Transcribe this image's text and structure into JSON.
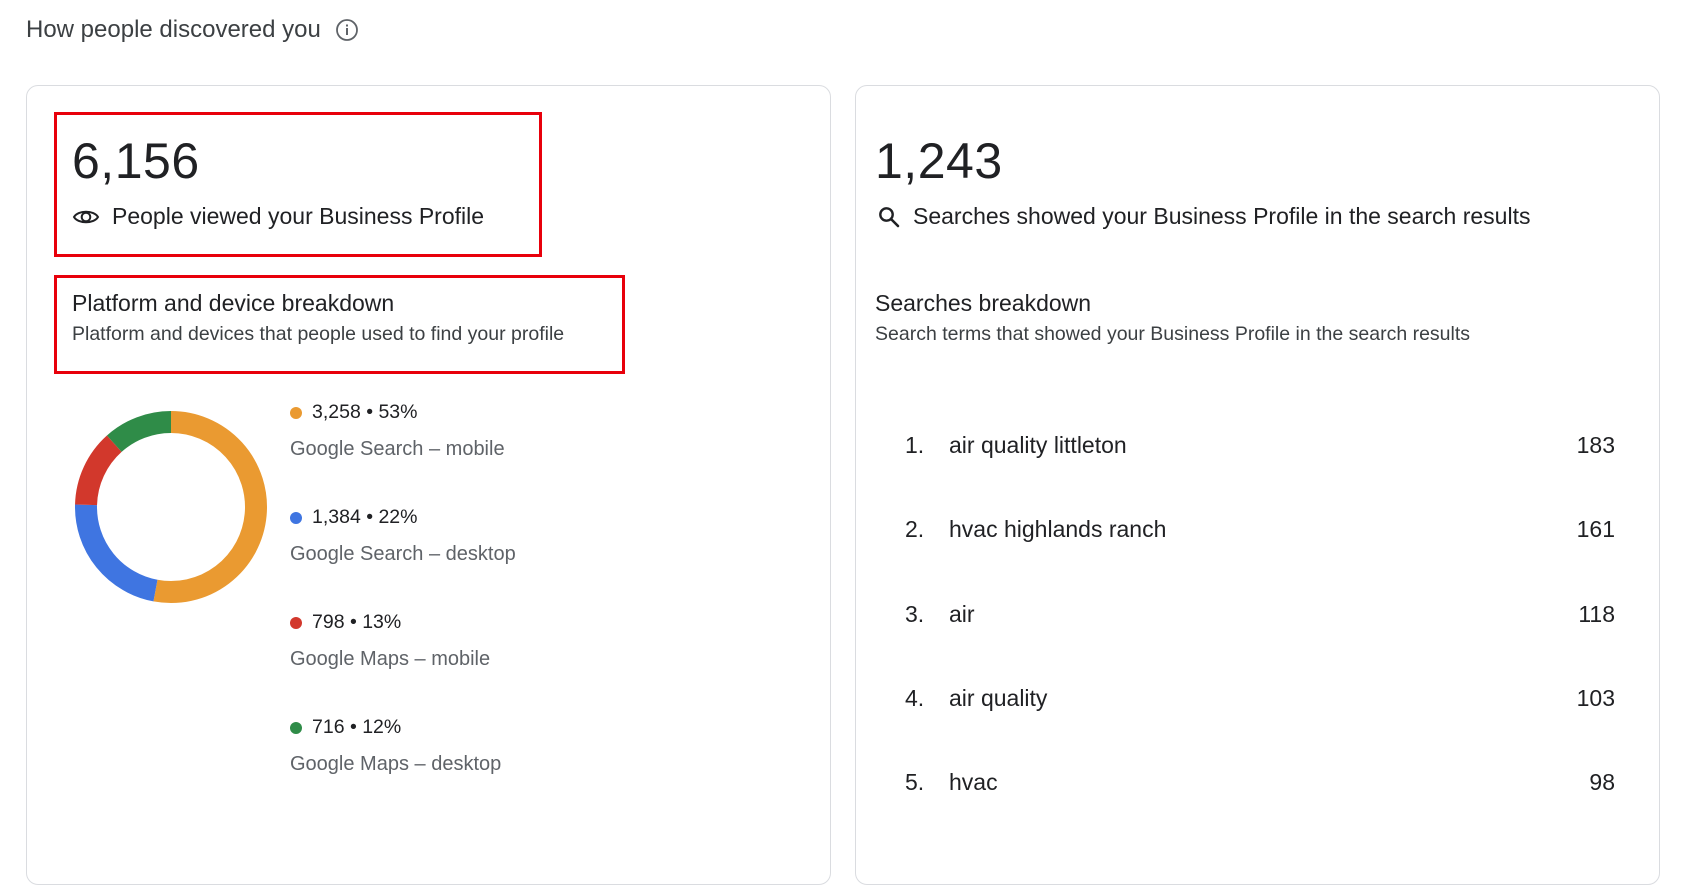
{
  "header": {
    "title": "How people discovered you",
    "info_icon": "info-icon"
  },
  "views_card": {
    "total": "6,156",
    "total_label": "People viewed your Business Profile",
    "total_icon": "eye-icon",
    "breakdown_title": "Platform and device breakdown",
    "breakdown_subtitle": "Platform and devices that people used to find your profile",
    "items": [
      {
        "summary": "3,258 • 53%",
        "label": "Google Search – mobile",
        "value": 3258,
        "percent": 53,
        "color": "#ea9a31"
      },
      {
        "summary": "1,384 • 22%",
        "label": "Google Search – desktop",
        "value": 1384,
        "percent": 22,
        "color": "#3f75e1"
      },
      {
        "summary": "798 • 13%",
        "label": "Google Maps – mobile",
        "value": 798,
        "percent": 13,
        "color": "#d2382c"
      },
      {
        "summary": "716 • 12%",
        "label": "Google Maps – desktop",
        "value": 716,
        "percent": 12,
        "color": "#2f8c48"
      }
    ]
  },
  "searches_card": {
    "total": "1,243",
    "total_label": "Searches showed your Business Profile in the search results",
    "total_icon": "search-icon",
    "breakdown_title": "Searches breakdown",
    "breakdown_subtitle": "Search terms that showed your Business Profile in the search results",
    "terms": [
      {
        "rank": "1.",
        "term": "air quality littleton",
        "count": "183"
      },
      {
        "rank": "2.",
        "term": "hvac highlands ranch",
        "count": "161"
      },
      {
        "rank": "3.",
        "term": "air",
        "count": "118"
      },
      {
        "rank": "4.",
        "term": "air quality",
        "count": "103"
      },
      {
        "rank": "5.",
        "term": "hvac",
        "count": "98"
      }
    ]
  },
  "annotation_color": "#e8000b"
}
